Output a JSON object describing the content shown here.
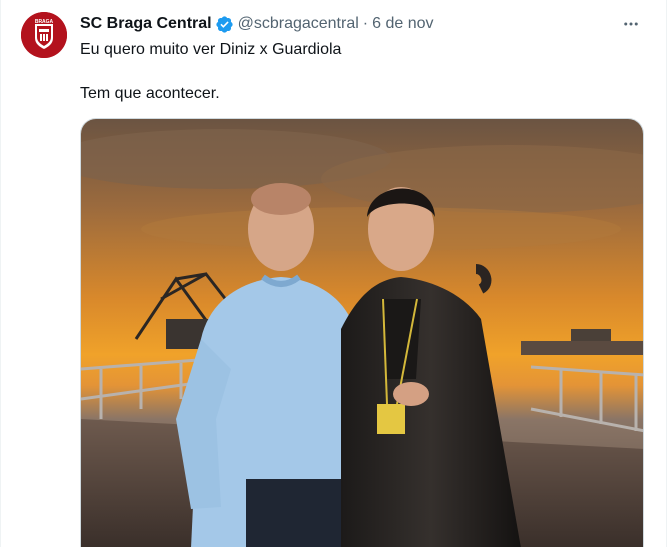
{
  "tweet": {
    "display_name": "SC Braga Central",
    "handle": "@scbragacentral",
    "separator": "·",
    "date": "6 de nov",
    "text_line1": "Eu quero muito ver Diniz x Guardiola",
    "text_line2": "Tem que acontecer.",
    "verified_icon": "verified-badge-icon",
    "more_icon": "more-options-icon",
    "avatar_label": "BRAGA"
  },
  "colors": {
    "verified": "#1d9bf0",
    "avatar_bg": "#b3121d",
    "muted": "#536471"
  }
}
